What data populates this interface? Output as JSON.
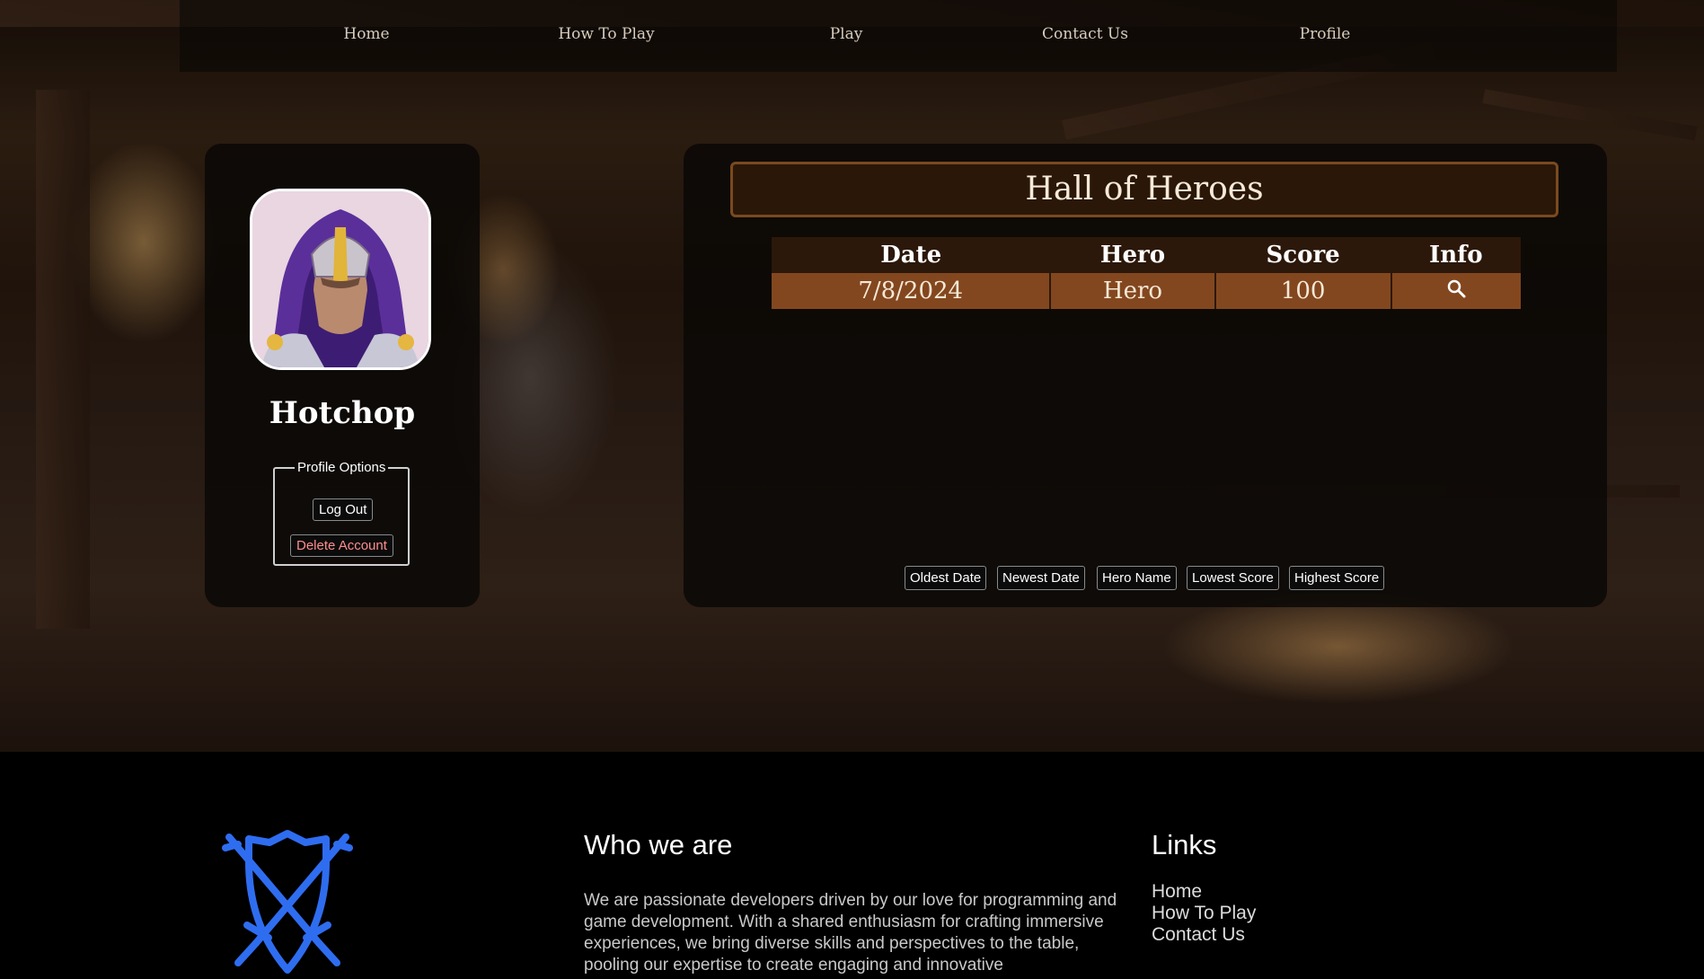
{
  "nav": {
    "items": [
      "Home",
      "How To Play",
      "Play",
      "Contact Us",
      "Profile"
    ]
  },
  "profile": {
    "username": "Hotchop",
    "options_legend": "Profile Options",
    "logout_label": "Log Out",
    "delete_label": "Delete Account"
  },
  "hall": {
    "title": "Hall of Heroes",
    "columns": [
      "Date",
      "Hero",
      "Score",
      "Info"
    ],
    "rows": [
      {
        "date": "7/8/2024",
        "hero": "Hero",
        "score": "100",
        "info_icon": "magnifier-icon"
      }
    ],
    "sort_buttons": [
      "Oldest Date",
      "Newest Date",
      "Hero Name",
      "Lowest Score",
      "Highest Score"
    ]
  },
  "footer": {
    "who_title": "Who we are",
    "who_text": "We are passionate developers driven by our love for programming and game development. With a shared enthusiasm for crafting immersive experiences, we bring diverse skills and perspectives to the table, pooling our expertise to create engaging and innovative",
    "links_title": "Links",
    "links": [
      "Home",
      "How To Play",
      "Contact Us"
    ]
  },
  "colors": {
    "accent_brown": "#83471f",
    "header_brown": "#2c180a",
    "logo_blue": "#2f6df0",
    "danger_text": "#ff8d8d"
  }
}
